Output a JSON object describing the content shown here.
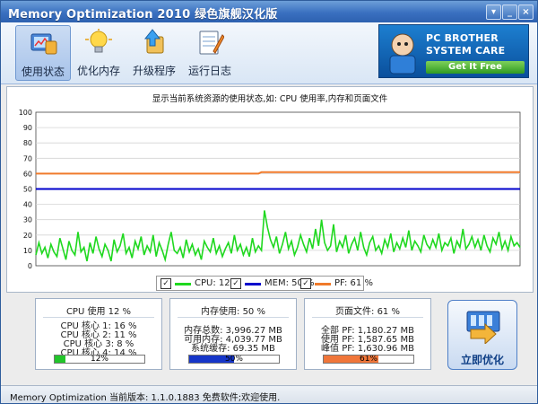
{
  "window": {
    "title": "Memory Optimization 2010 绿色旗舰汉化版",
    "controls": [
      "▾",
      "_",
      "×"
    ]
  },
  "toolbar": {
    "items": [
      {
        "label": "使用状态",
        "icon": "monitor-status-icon",
        "active": true
      },
      {
        "label": "优化内存",
        "icon": "lightbulb-icon",
        "active": false
      },
      {
        "label": "升级程序",
        "icon": "upgrade-icon",
        "active": false
      },
      {
        "label": "运行日志",
        "icon": "log-notepad-icon",
        "active": false
      }
    ]
  },
  "banner": {
    "line1": "PC BROTHER",
    "line2": "SYSTEM CARE",
    "button": "Get It Free"
  },
  "chart_data": {
    "type": "line",
    "title": "显示当前系统资源的使用状态,如: CPU 使用率,内存和页面文件",
    "ylim": [
      0,
      100
    ],
    "yticks": [
      0,
      10,
      20,
      30,
      40,
      50,
      60,
      70,
      80,
      90,
      100
    ],
    "grid": true,
    "legend_position": "bottom-center",
    "series": [
      {
        "name": "CPU: 12 %",
        "color": "#1fd81f",
        "values": [
          7,
          15,
          8,
          12,
          5,
          14,
          9,
          6,
          18,
          11,
          4,
          16,
          10,
          7,
          22,
          9,
          12,
          3,
          15,
          8,
          19,
          11,
          6,
          14,
          10,
          3,
          17,
          9,
          13,
          21,
          8,
          12,
          5,
          16,
          11,
          19,
          7,
          13,
          9,
          20,
          6,
          15,
          10,
          4,
          14,
          22,
          10,
          8,
          12,
          5,
          17,
          9,
          14,
          7,
          11,
          4,
          16,
          12,
          9,
          18,
          8,
          13,
          6,
          11,
          15,
          8,
          20,
          10,
          14,
          7,
          12,
          6,
          18,
          9,
          13,
          10,
          36,
          25,
          17,
          12,
          19,
          8,
          14,
          22,
          11,
          16,
          7,
          12,
          20,
          14,
          9,
          18,
          11,
          24,
          13,
          30,
          15,
          10,
          13,
          27,
          9,
          16,
          12,
          20,
          8,
          14,
          18,
          10,
          22,
          12,
          7,
          15,
          19,
          10,
          13,
          8,
          17,
          12,
          21,
          9,
          15,
          11,
          18,
          12,
          23,
          10,
          16,
          13,
          9,
          20,
          14,
          11,
          17,
          12,
          21,
          10,
          15,
          13,
          18,
          8,
          16,
          12,
          24,
          11,
          14,
          19,
          12,
          17,
          10,
          20,
          13,
          9,
          18,
          14,
          22,
          11,
          16,
          10,
          19,
          13,
          15,
          12
        ]
      },
      {
        "name": "MEM: 50 %",
        "color": "#0000cc",
        "values": [
          50,
          50,
          50,
          50,
          50,
          50,
          50,
          50,
          50,
          50,
          50,
          50,
          50,
          50,
          50,
          50,
          50,
          50,
          50,
          50,
          50,
          50,
          50,
          50,
          50,
          50,
          50,
          50,
          50,
          50,
          50,
          50,
          50,
          50,
          50,
          50,
          50,
          50,
          50,
          50,
          50,
          50,
          50,
          50,
          50,
          50,
          50,
          50,
          50,
          50,
          50,
          50,
          50,
          50,
          50,
          50,
          50,
          50,
          50,
          50,
          50,
          50,
          50,
          50,
          50,
          50,
          50,
          50,
          50,
          50,
          50,
          50,
          50,
          50,
          50,
          50,
          50,
          50,
          50,
          50,
          50,
          50,
          50,
          50,
          50,
          50,
          50,
          50,
          50,
          50,
          50,
          50,
          50,
          50,
          50,
          50,
          50,
          50,
          50,
          50,
          50,
          50,
          50,
          50,
          50,
          50,
          50,
          50,
          50,
          50,
          50,
          50,
          50,
          50,
          50,
          50,
          50,
          50,
          50,
          50,
          50,
          50,
          50,
          50,
          50,
          50,
          50,
          50,
          50,
          50,
          50,
          50,
          50,
          50,
          50,
          50,
          50,
          50,
          50,
          50,
          50,
          50,
          50,
          50,
          50,
          50,
          50,
          50,
          50,
          50,
          50,
          50,
          50,
          50,
          50,
          50,
          50,
          50,
          50,
          50,
          50,
          50
        ]
      },
      {
        "name": "PF: 61 %",
        "color": "#f07a2a",
        "values": [
          60,
          60,
          60,
          60,
          60,
          60,
          60,
          60,
          60,
          60,
          60,
          60,
          60,
          60,
          60,
          60,
          60,
          60,
          60,
          60,
          60,
          60,
          60,
          60,
          60,
          60,
          60,
          60,
          60,
          60,
          60,
          60,
          60,
          60,
          60,
          60,
          60,
          60,
          60,
          60,
          60,
          60,
          60,
          60,
          60,
          60,
          60,
          60,
          60,
          60,
          60,
          60,
          60,
          60,
          60,
          60,
          60,
          60,
          60,
          60,
          60,
          60,
          60,
          60,
          60,
          60,
          60,
          60,
          60,
          60,
          60,
          60,
          60,
          60,
          60,
          61,
          61,
          61,
          61,
          61,
          61,
          61,
          61,
          61,
          61,
          61,
          61,
          61,
          61,
          61,
          61,
          61,
          61,
          61,
          61,
          61,
          61,
          61,
          61,
          61,
          61,
          61,
          61,
          61,
          61,
          61,
          61,
          61,
          61,
          61,
          61,
          61,
          61,
          61,
          61,
          61,
          61,
          61,
          61,
          61,
          61,
          61,
          61,
          61,
          61,
          61,
          61,
          61,
          61,
          61,
          61,
          61,
          61,
          61,
          61,
          61,
          61,
          61,
          61,
          61,
          61,
          61,
          61,
          61,
          61,
          61,
          61,
          61,
          61,
          61,
          61,
          61,
          61,
          61,
          61,
          61,
          61,
          61,
          61,
          61,
          61,
          61
        ]
      }
    ]
  },
  "panels": {
    "cpu": {
      "title": "CPU 使用 12 %",
      "lines": [
        "CPU 核心 1: 16 %",
        "CPU 核心 2: 11 %",
        "CPU 核心 3: 8 %",
        "CPU 核心 4: 14 %"
      ],
      "percent_label": "12%",
      "fill_fraction": 0.12,
      "color": "#22c52a"
    },
    "memory": {
      "title": "内存使用: 50 %",
      "lines": [
        "内存总数: 3,996.27 MB",
        "可用内存: 4,039.77 MB",
        "系统缓存: 69.35 MB"
      ],
      "percent_label": "50%",
      "fill_fraction": 0.5,
      "color": "#1636c8"
    },
    "pagefile": {
      "title": "页面文件: 61 %",
      "lines": [
        "全部  PF: 1,180.27 MB",
        "使用  PF: 1,587.65 MB",
        "峰值  PF: 1,630.96 MB"
      ],
      "percent_label": "61%",
      "fill_fraction": 0.61,
      "color": "#f0763a"
    }
  },
  "optimize_button": {
    "label": "立即优化",
    "icon": "optimize-memory-icon"
  },
  "statusbar": {
    "text": "Memory Optimization 当前版本: 1.1.0.1883 免费软件;欢迎使用."
  }
}
